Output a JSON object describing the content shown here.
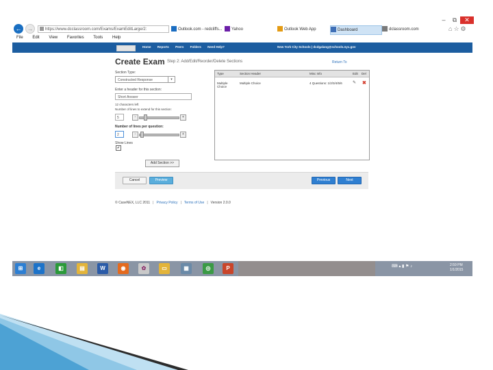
{
  "window": {
    "minimize": "–",
    "restore": "⧉",
    "close": "✕"
  },
  "browser": {
    "back_glyph": "←",
    "forward_glyph": "→",
    "address": "https://www.dcclassroom.com/Exams/ExamEditLarge/2:",
    "tabs": [
      {
        "label": "Outlook.com - redcliffs...",
        "icon": "outlook-icon",
        "color": "#1b6dc1"
      },
      {
        "label": "Yahoo",
        "icon": "yahoo-icon",
        "color": "#6b1fa8"
      },
      {
        "label": "Outlook Web App",
        "icon": "owa-icon",
        "color": "#e49b14"
      },
      {
        "label": "Dashboard",
        "icon": "dashboard-icon",
        "color": "#3f6fb6"
      },
      {
        "label": "dclassroom.com",
        "icon": "site-icon",
        "color": "#7a7a7a"
      }
    ],
    "menu": [
      "File",
      "Edit",
      "View",
      "Favorites",
      "Tools",
      "Help"
    ]
  },
  "site_nav": {
    "links": [
      "Home",
      "Reports",
      "Peers",
      "Folders",
      "Need Help?"
    ],
    "user": "New York City Schools | dcdgalang@schools.nyc.gov"
  },
  "page": {
    "title": "Create Exam",
    "step": "Step 2: Add/Edit/Reorder/Delete Sections",
    "return_link": "Return To"
  },
  "form": {
    "section_type_label": "Section Type:",
    "section_type_value": "Constructed Response",
    "header_label": "Enter a header for this section:",
    "header_value": "Short Answer",
    "chars_remaining": "12 characters left",
    "lines_label": "Number of lines to extend for this section:",
    "lines_value": "5",
    "lines_per_question_label": "Number of lines per question:",
    "lines_per_question_value": "2",
    "show_lines_label": "Show Lines",
    "show_lines_checked": "✔",
    "add_section_button": "Add Section >>",
    "slider_minus": "-",
    "slider_plus": "+"
  },
  "sections_table": {
    "columns": [
      "Type",
      "Section Header",
      "Misc Info",
      "Edit",
      "Del"
    ],
    "rows": [
      {
        "type": "Multiple Choice",
        "header": "Multiple Choice",
        "misc": "4 Questions: 1/2/3/4/5/6",
        "edit_icon": "✎",
        "delete_icon": "✖"
      }
    ]
  },
  "actions": {
    "cancel": "Cancel",
    "preview": "Preview",
    "previous": "Previous",
    "next": "Next"
  },
  "footer": {
    "copyright": "© CaseNEX, LLC 2011",
    "privacy": "Privacy Policy",
    "terms": "Terms of Use",
    "version": "Version 2.0.0"
  },
  "taskbar": {
    "clock_time": "2:59 PM",
    "clock_date": "1/1/2015",
    "apps": [
      {
        "name": "windows-start-icon",
        "glyph": "⊞",
        "color": "#2d7fd3"
      },
      {
        "name": "internet-explorer-icon",
        "glyph": "e",
        "color": "#1d73c9"
      },
      {
        "name": "store-icon",
        "glyph": "◧",
        "color": "#2b9a3a"
      },
      {
        "name": "file-explorer-icon",
        "glyph": "▤",
        "color": "#e3b43a"
      },
      {
        "name": "word-icon",
        "glyph": "W",
        "color": "#2a5ba8"
      },
      {
        "name": "firefox-icon",
        "glyph": "◉",
        "color": "#e46a1e"
      },
      {
        "name": "paint-icon",
        "glyph": "✿",
        "color": "#c9c9c9"
      },
      {
        "name": "folder-icon",
        "glyph": "▭",
        "color": "#e3b43a"
      },
      {
        "name": "calculator-icon",
        "glyph": "▦",
        "color": "#6a8aa8"
      },
      {
        "name": "chrome-icon",
        "glyph": "◎",
        "color": "#3a9a45"
      },
      {
        "name": "powerpoint-icon",
        "glyph": "P",
        "color": "#c9452a"
      }
    ]
  }
}
